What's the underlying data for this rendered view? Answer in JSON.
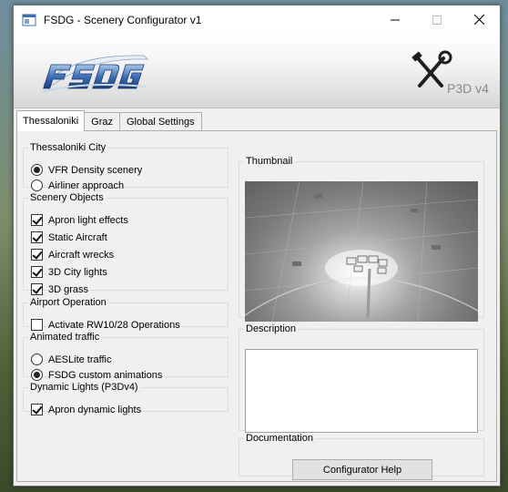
{
  "window": {
    "title": "FSDG - Scenery Configurator v1",
    "minimize_glyph": "—",
    "maximize_glyph": "☐",
    "close_glyph": "✕"
  },
  "banner": {
    "logo_left": "FSDG",
    "logo_right": "P3D v4"
  },
  "tabs": [
    {
      "label": "Thessaloniki",
      "active": true
    },
    {
      "label": "Graz",
      "active": false
    },
    {
      "label": "Global Settings",
      "active": false
    }
  ],
  "groups": {
    "city": {
      "title": "Thessaloniki City",
      "options": [
        {
          "label": "VFR Density scenery",
          "checked": true
        },
        {
          "label": "Airliner approach",
          "checked": false
        }
      ]
    },
    "objects": {
      "title": "Scenery Objects",
      "options": [
        {
          "label": "Apron light effects",
          "checked": true
        },
        {
          "label": "Static Aircraft",
          "checked": true
        },
        {
          "label": "Aircraft wrecks",
          "checked": true
        },
        {
          "label": "3D City lights",
          "checked": true
        },
        {
          "label": "3D grass",
          "checked": true
        }
      ]
    },
    "airport": {
      "title": "Airport Operation",
      "options": [
        {
          "label": "Activate RW10/28 Operations",
          "checked": false
        }
      ]
    },
    "traffic": {
      "title": "Animated traffic",
      "options": [
        {
          "label": "AESLite traffic",
          "checked": false
        },
        {
          "label": "FSDG custom animations",
          "checked": true
        }
      ]
    },
    "lights": {
      "title": "Dynamic Lights (P3Dv4)",
      "options": [
        {
          "label": "Apron dynamic lights",
          "checked": true
        }
      ]
    }
  },
  "right": {
    "thumbnail_title": "Thumbnail",
    "description_title": "Description",
    "description_text": "",
    "documentation_title": "Documentation",
    "help_button": "Configurator Help"
  }
}
